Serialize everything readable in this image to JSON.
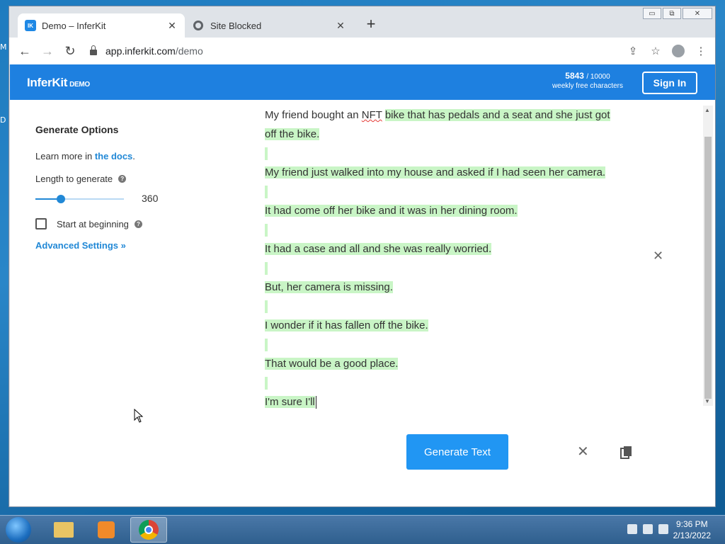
{
  "desktop": {
    "letters": [
      "M",
      "D"
    ]
  },
  "browser": {
    "tabs": [
      {
        "favicon": "IK",
        "title": "Demo – InferKit",
        "active": true
      },
      {
        "favicon": "globe-icon",
        "title": "Site Blocked",
        "active": false
      }
    ],
    "new_tab_label": "+",
    "url_host": "app.inferkit.com",
    "url_path": "/demo",
    "window_controls": {
      "minimize": "▭",
      "restore": "⧉",
      "close": "✕"
    }
  },
  "app": {
    "brand": "InferKit",
    "brand_tag": "DEMO",
    "credits_used": "5843",
    "credits_total": "/ 10000",
    "credits_label": "weekly free characters",
    "sign_in": "Sign In"
  },
  "options": {
    "title": "Generate Options",
    "learn_prefix": "Learn more in ",
    "docs_link": "the docs",
    "learn_suffix": ".",
    "length_label": "Length to generate",
    "length_value": "360",
    "length_fraction": 0.29,
    "start_label": "Start at beginning",
    "start_checked": false,
    "advanced": "Advanced Settings »"
  },
  "output": {
    "prompt_a": "My friend bought an ",
    "prompt_nft": "NFT",
    "generated_first": "bike that has pedals and a seat and she just got",
    "generated_first_2": "off the bike.",
    "lines": [
      "My friend just walked into my house and asked if I had seen her camera.",
      "It had come off her bike and it was in her dining room.",
      "It had a case and all and she was really worried.",
      "But, her camera is missing.",
      "I wonder if it has fallen off the bike.",
      "That would be a good place.",
      "I'm sure I'll"
    ]
  },
  "actions": {
    "generate": "Generate Text"
  },
  "taskbar": {
    "time": "9:36 PM",
    "date": "2/13/2022"
  }
}
